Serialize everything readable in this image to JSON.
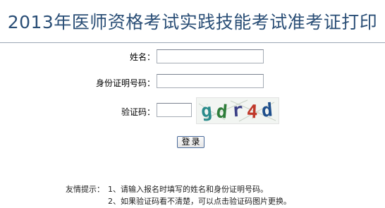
{
  "header": {
    "title": "2013年医师资格考试实践技能考试准考证打印"
  },
  "form": {
    "name_label": "姓名：",
    "name_value": "",
    "id_label": "身份证明号码：",
    "id_value": "",
    "captcha_label": "验证码：",
    "captcha_value": "",
    "captcha_text": "gdr4d",
    "submit_label": "登录"
  },
  "tips": {
    "prefix": "友情提示：",
    "line1": "1、请输入报名时填写的姓名和身份证明号码。",
    "line2": "2、如果验证码看不清楚，可以点击验证码图片更换。"
  }
}
